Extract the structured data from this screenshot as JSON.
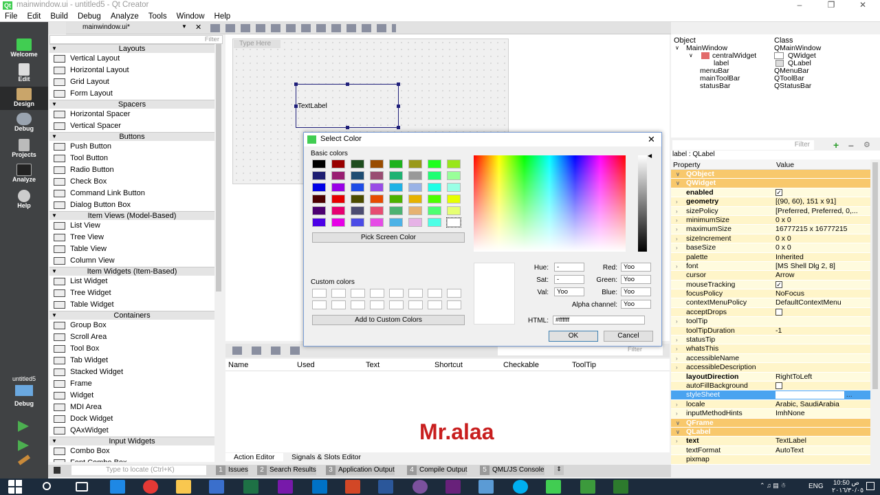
{
  "window": {
    "title": "mainwindow.ui - untitled5 - Qt Creator",
    "app_icon": "qt-icon"
  },
  "menu": [
    "File",
    "Edit",
    "Build",
    "Debug",
    "Analyze",
    "Tools",
    "Window",
    "Help"
  ],
  "modes": [
    {
      "label": "Welcome"
    },
    {
      "label": "Edit"
    },
    {
      "label": "Design"
    },
    {
      "label": "Debug"
    },
    {
      "label": "Projects"
    },
    {
      "label": "Analyze"
    },
    {
      "label": "Help"
    }
  ],
  "project_target": {
    "label": "untitled5",
    "sub": "Debug"
  },
  "editor": {
    "file": "mainwindow.ui*",
    "type_here": "Type Here",
    "label_text": "TextLabel"
  },
  "widget_box": {
    "filter_placeholder": "Filter",
    "sections": [
      {
        "title": "Layouts",
        "items": [
          "Vertical Layout",
          "Horizontal Layout",
          "Grid Layout",
          "Form Layout"
        ]
      },
      {
        "title": "Spacers",
        "items": [
          "Horizontal Spacer",
          "Vertical Spacer"
        ]
      },
      {
        "title": "Buttons",
        "items": [
          "Push Button",
          "Tool Button",
          "Radio Button",
          "Check Box",
          "Command Link Button",
          "Dialog Button Box"
        ]
      },
      {
        "title": "Item Views (Model-Based)",
        "items": [
          "List View",
          "Tree View",
          "Table View",
          "Column View"
        ]
      },
      {
        "title": "Item Widgets (Item-Based)",
        "items": [
          "List Widget",
          "Tree Widget",
          "Table Widget"
        ]
      },
      {
        "title": "Containers",
        "items": [
          "Group Box",
          "Scroll Area",
          "Tool Box",
          "Tab Widget",
          "Stacked Widget",
          "Frame",
          "Widget",
          "MDI Area",
          "Dock Widget",
          "QAxWidget"
        ]
      },
      {
        "title": "Input Widgets",
        "items": [
          "Combo Box",
          "Font Combo Box"
        ]
      }
    ]
  },
  "action_editor": {
    "filter_placeholder": "Filter",
    "columns": [
      "Name",
      "Used",
      "Text",
      "Shortcut",
      "Checkable",
      "ToolTip"
    ],
    "tabs": [
      "Action Editor",
      "Signals & Slots Editor"
    ]
  },
  "watermark": "Mr.alaa",
  "object_inspector": {
    "headers": [
      "Object",
      "Class"
    ],
    "rows": [
      {
        "object": "MainWindow",
        "class": "QMainWindow"
      },
      {
        "object": "centralWidget",
        "class": "QWidget"
      },
      {
        "object": "label",
        "class": "QLabel"
      },
      {
        "object": "menuBar",
        "class": "QMenuBar"
      },
      {
        "object": "mainToolBar",
        "class": "QToolBar"
      },
      {
        "object": "statusBar",
        "class": "QStatusBar"
      }
    ]
  },
  "property_editor": {
    "filter_placeholder": "Filter",
    "object_label": "label : QLabel",
    "headers": [
      "Property",
      "Value"
    ],
    "rows": [
      {
        "name": "QObject",
        "value": "",
        "kind": "group"
      },
      {
        "name": "QWidget",
        "value": "",
        "kind": "group"
      },
      {
        "name": "enabled",
        "value": "",
        "check": true,
        "bold": true
      },
      {
        "name": "geometry",
        "value": "[(90, 60), 151 x 91]",
        "bold": true,
        "expand": true
      },
      {
        "name": "sizePolicy",
        "value": "[Preferred, Preferred, 0,...",
        "expand": true
      },
      {
        "name": "minimumSize",
        "value": "0 x 0",
        "expand": true
      },
      {
        "name": "maximumSize",
        "value": "16777215 x 16777215",
        "expand": true
      },
      {
        "name": "sizeIncrement",
        "value": "0 x 0",
        "expand": true
      },
      {
        "name": "baseSize",
        "value": "0 x 0",
        "expand": true
      },
      {
        "name": "palette",
        "value": "Inherited"
      },
      {
        "name": "font",
        "value": "[MS Shell Dlg 2, 8]",
        "expand": true
      },
      {
        "name": "cursor",
        "value": "Arrow"
      },
      {
        "name": "mouseTracking",
        "value": "",
        "check": true
      },
      {
        "name": "focusPolicy",
        "value": "NoFocus"
      },
      {
        "name": "contextMenuPolicy",
        "value": "DefaultContextMenu"
      },
      {
        "name": "acceptDrops",
        "value": "",
        "check": false
      },
      {
        "name": "toolTip",
        "value": "",
        "expand": true
      },
      {
        "name": "toolTipDuration",
        "value": "-1"
      },
      {
        "name": "statusTip",
        "value": "",
        "expand": true
      },
      {
        "name": "whatsThis",
        "value": "",
        "expand": true
      },
      {
        "name": "accessibleName",
        "value": "",
        "expand": true
      },
      {
        "name": "accessibleDescription",
        "value": "",
        "expand": true
      },
      {
        "name": "layoutDirection",
        "value": "RightToLeft",
        "bold": true
      },
      {
        "name": "autoFillBackground",
        "value": "",
        "check": false
      },
      {
        "name": "styleSheet",
        "value": "",
        "selected": true
      },
      {
        "name": "locale",
        "value": "Arabic, SaudiArabia",
        "expand": true
      },
      {
        "name": "inputMethodHints",
        "value": "ImhNone",
        "expand": true
      },
      {
        "name": "QFrame",
        "value": "",
        "kind": "group"
      },
      {
        "name": "QLabel",
        "value": "",
        "kind": "group"
      },
      {
        "name": "text",
        "value": "TextLabel",
        "bold": true,
        "expand": true
      },
      {
        "name": "textFormat",
        "value": "AutoText"
      },
      {
        "name": "pixmap",
        "value": ""
      }
    ]
  },
  "bottom_panes": {
    "locate_placeholder": "Type to locate (Ctrl+K)",
    "panes": [
      {
        "num": "1",
        "label": "Issues"
      },
      {
        "num": "2",
        "label": "Search Results"
      },
      {
        "num": "3",
        "label": "Application Output"
      },
      {
        "num": "4",
        "label": "Compile Output"
      },
      {
        "num": "5",
        "label": "QML/JS Console"
      }
    ]
  },
  "taskbar": {
    "lang": "ENG",
    "time": "10:50 ص",
    "date": "٢٠١٦/٣٠/٠٥"
  },
  "color_dialog": {
    "title": "Select Color",
    "basic_colors_label": "Basic colors",
    "basic_colors": [
      "#000000",
      "#990000",
      "#1e4c1e",
      "#994c00",
      "#1eb21e",
      "#999919",
      "#1eff1e",
      "#99e619",
      "#1e1e72",
      "#991e72",
      "#1e4c72",
      "#994c72",
      "#1eb272",
      "#999999",
      "#1eff72",
      "#99ff99",
      "#0000e6",
      "#9900e6",
      "#1e4ce6",
      "#994ce6",
      "#1eb2e6",
      "#99b2e6",
      "#1effe6",
      "#99ffe6",
      "#4c0000",
      "#e60000",
      "#4c4c00",
      "#e64c00",
      "#4cb200",
      "#e6b200",
      "#4cff00",
      "#e6ff00",
      "#4c0072",
      "#e60072",
      "#4c4c72",
      "#e64c72",
      "#4cb272",
      "#e6b272",
      "#4cff72",
      "#e6ff72",
      "#4c00e6",
      "#e600e6",
      "#4c4ce6",
      "#e64ce6",
      "#4cb2e6",
      "#e6b2e6",
      "#4cffe6",
      "#ffffff"
    ],
    "pick_screen": "Pick Screen Color",
    "custom_colors_label": "Custom colors",
    "add_custom": "Add to Custom Colors",
    "hue_label": "Hue:",
    "hue_value": "-",
    "sat_label": "Sat:",
    "sat_value": "-",
    "val_label": "Val:",
    "val_value": "Yoo",
    "red_label": "Red:",
    "red_value": "Yoo",
    "green_label": "Green:",
    "green_value": "Yoo",
    "blue_label": "Blue:",
    "blue_value": "Yoo",
    "alpha_label": "Alpha channel:",
    "alpha_value": "Yoo",
    "html_label": "HTML:",
    "html_value": "#ffffff",
    "ok": "OK",
    "cancel": "Cancel"
  }
}
